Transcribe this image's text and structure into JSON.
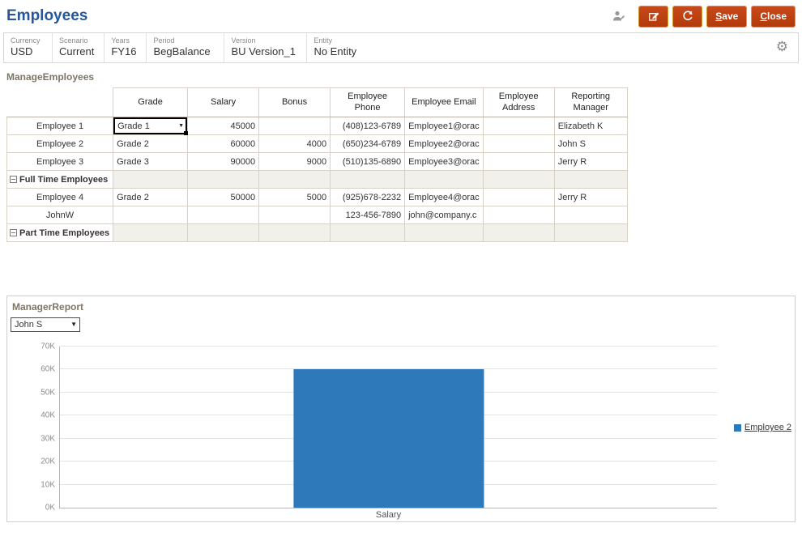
{
  "header": {
    "title": "Employees",
    "save_label": "Save",
    "close_label": "Close"
  },
  "icons": {
    "settings": "⚙",
    "dropdown_arrow": "▼"
  },
  "pov": {
    "items": [
      {
        "label": "Currency",
        "value": "USD"
      },
      {
        "label": "Scenario",
        "value": "Current"
      },
      {
        "label": "Years",
        "value": "FY16"
      },
      {
        "label": "Period",
        "value": "BegBalance"
      },
      {
        "label": "Version",
        "value": "BU Version_1"
      },
      {
        "label": "Entity",
        "value": "No Entity"
      }
    ]
  },
  "grid": {
    "title": "ManageEmployees",
    "columns": [
      "Grade",
      "Salary",
      "Bonus",
      "Employee Phone",
      "Employee Email",
      "Employee Address",
      "Reporting Manager"
    ],
    "rows": [
      {
        "label": "Employee 1",
        "total": false,
        "grade_dropdown": true,
        "cells": [
          "Grade 1",
          "45000",
          "",
          "(408)123-6789",
          "Employee1@orac",
          "",
          "Elizabeth K"
        ]
      },
      {
        "label": "Employee 2",
        "total": false,
        "cells": [
          "Grade 2",
          "60000",
          "4000",
          "(650)234-6789",
          "Employee2@orac",
          "",
          "John S"
        ]
      },
      {
        "label": "Employee 3",
        "total": false,
        "cells": [
          "Grade 3",
          "90000",
          "9000",
          "(510)135-6890",
          "Employee3@orac",
          "",
          "Jerry R"
        ]
      },
      {
        "label": "Full Time Employees",
        "total": true,
        "cells": [
          "",
          "",
          "",
          "",
          "",
          "",
          ""
        ]
      },
      {
        "label": "Employee 4",
        "total": false,
        "cells": [
          "Grade 2",
          "50000",
          "5000",
          "(925)678-2232",
          "Employee4@orac",
          "",
          "Jerry R"
        ]
      },
      {
        "label": "JohnW",
        "total": false,
        "cells": [
          "",
          "",
          "",
          "123-456-7890",
          "john@company.c",
          "",
          ""
        ]
      },
      {
        "label": "Part Time Employees",
        "total": true,
        "cells": [
          "",
          "",
          "",
          "",
          "",
          "",
          ""
        ]
      }
    ]
  },
  "report": {
    "title": "ManagerReport",
    "selector_value": "John S"
  },
  "chart_data": {
    "type": "bar",
    "title": "ManagerReport",
    "categories": [
      "Salary"
    ],
    "series": [
      {
        "name": "Employee 2",
        "values": [
          60000
        ]
      }
    ],
    "ylim": [
      0,
      70000
    ],
    "ytick_labels": [
      "0K",
      "10K",
      "20K",
      "30K",
      "40K",
      "50K",
      "60K",
      "70K"
    ],
    "grid": "horizontal",
    "legend_position": "right",
    "xlabel": "Salary",
    "color": "#2e79b9"
  }
}
